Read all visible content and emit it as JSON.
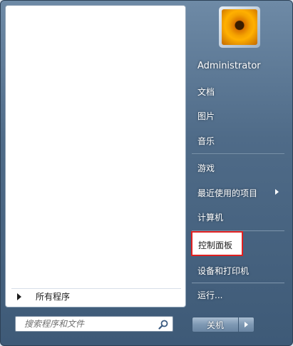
{
  "left_panel": {
    "all_programs_label": "所有程序",
    "search_placeholder": "搜索程序和文件"
  },
  "right_panel": {
    "user_name": "Administrator",
    "items": [
      {
        "label": "文档"
      },
      {
        "label": "图片"
      },
      {
        "label": "音乐"
      },
      {
        "label": "游戏"
      },
      {
        "label": "最近使用的项目"
      },
      {
        "label": "计算机"
      },
      {
        "label": "控制面板"
      },
      {
        "label": "设备和打印机"
      },
      {
        "label": "运行..."
      }
    ]
  },
  "shutdown": {
    "label": "关机"
  },
  "colors": {
    "highlight_border": "#e02020",
    "menu_background": "#4f6b88"
  },
  "icons": {
    "search": "search-icon",
    "all_programs_arrow": "triangle-right-icon",
    "submenu_arrow": "chevron-right-icon",
    "shutdown_options": "triangle-right-icon"
  }
}
